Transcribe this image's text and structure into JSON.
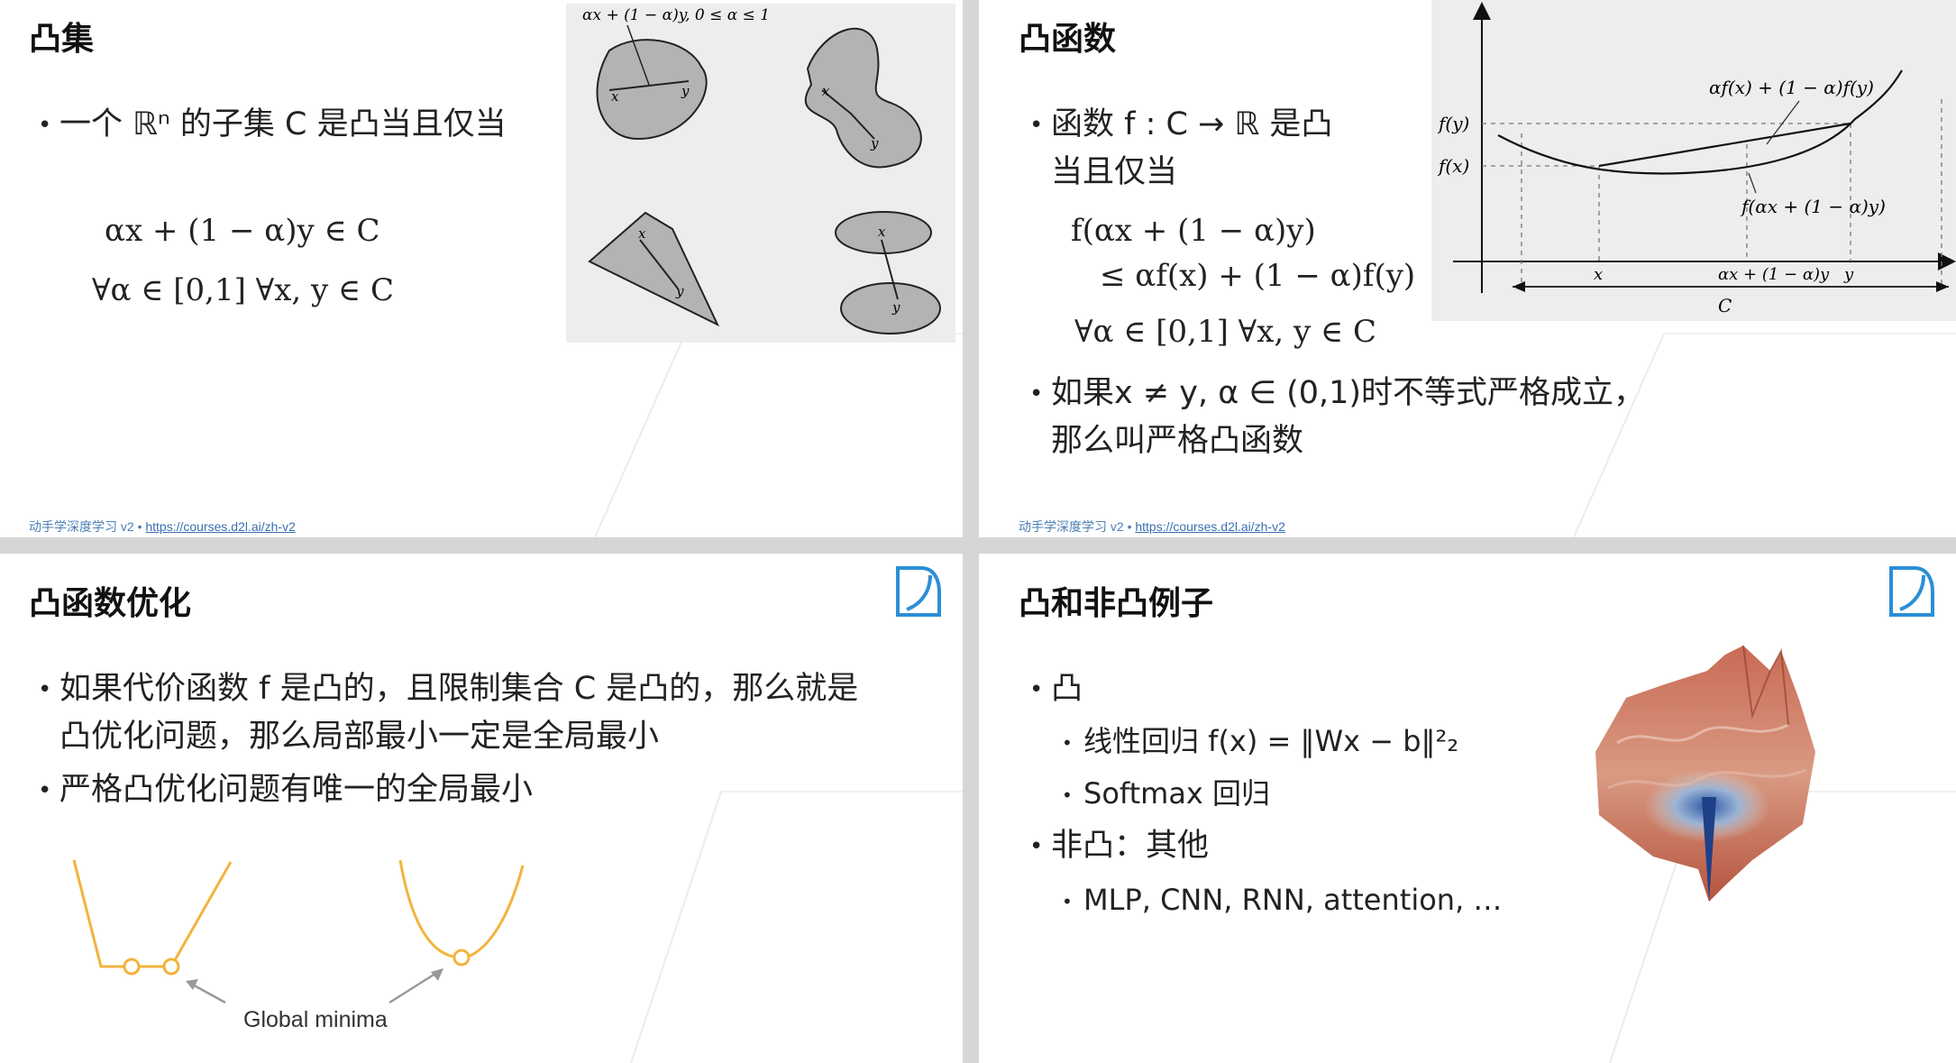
{
  "slide1": {
    "title": "凸集",
    "bullet": "一个 ℝⁿ 的子集 C 是凸当且仅当",
    "eq1": "αx + (1 − α)y ∈ C",
    "eq2": "∀α ∈ [0,1]  ∀x, y ∈ C",
    "figure_caption": "αx + (1 − α)y,  0 ≤ α ≤ 1",
    "point_x": "x",
    "point_y": "y",
    "footer_text": "动手学深度学习 v2 • ",
    "footer_link": "https://courses.d2l.ai/zh-v2"
  },
  "slide2": {
    "title": "凸函数",
    "bullet1_line1": "函数 f : C → ℝ 是凸",
    "bullet1_line2": "当且仅当",
    "eq1": "f(αx + (1 − α)y)",
    "eq2": "≤ αf(x) + (1 − α)f(y)",
    "eq3": "∀α ∈ [0,1]  ∀x, y ∈ C",
    "bullet2_line1": "如果x ≠ y, α ∈ (0,1)时不等式严格成立，",
    "bullet2_line2": "那么叫严格凸函数",
    "graph": {
      "label_fy": "f(y)",
      "label_fx": "f(x)",
      "label_chord": "αf(x) + (1 − α)f(y)",
      "label_curve": "f(αx + (1 − α)y)",
      "tick_x": "x",
      "tick_mid": "αx + (1 − α)y",
      "tick_y": "y",
      "label_C": "C"
    },
    "footer_text": "动手学深度学习 v2 • ",
    "footer_link": "https://courses.d2l.ai/zh-v2"
  },
  "slide3": {
    "title": "凸函数优化",
    "bullet1_line1": "如果代价函数 f 是凸的，且限制集合 C 是凸的，那么就是",
    "bullet1_line2": "凸优化问题，那么局部最小一定是全局最小",
    "bullet2": "严格凸优化问题有唯一的全局最小",
    "caption": "Global minima"
  },
  "slide4": {
    "title": "凸和非凸例子",
    "bullet1": "凸",
    "sub1": "线性回归 f(x) = ‖Wx − b‖²₂",
    "sub2": "Softmax 回归",
    "bullet2": "非凸：其他",
    "sub3": "MLP, CNN, RNN, attention, …"
  },
  "colors": {
    "accent_orange": "#f3b33d",
    "logo_blue": "#2b8fd6",
    "link_blue": "#3b6fb0",
    "figure_gray": "#ededed",
    "shape_gray": "#b3b3b3"
  }
}
